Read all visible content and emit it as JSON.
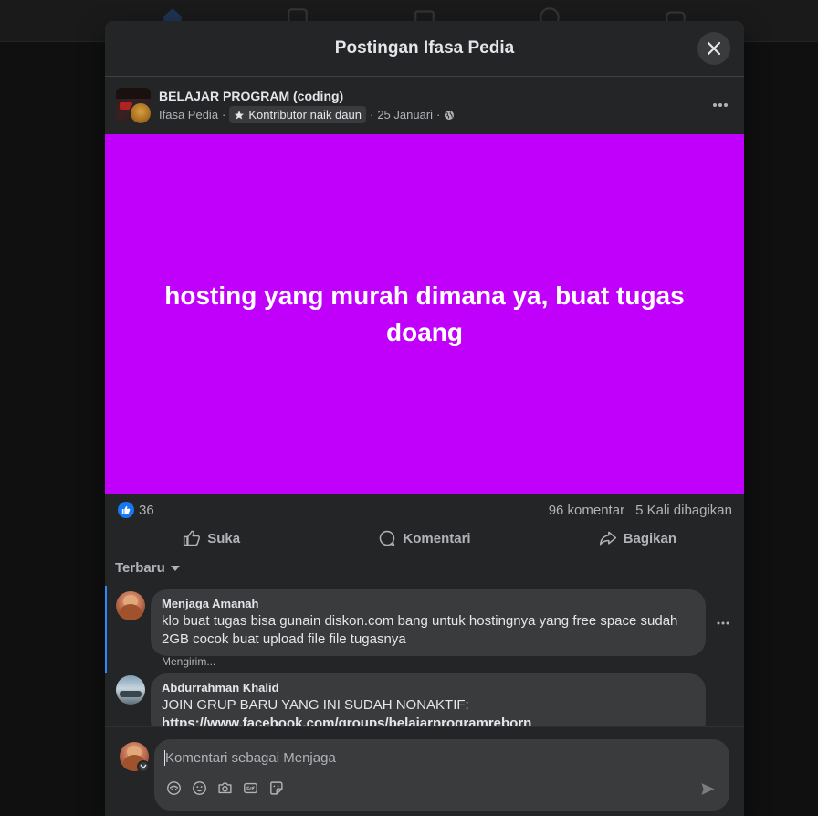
{
  "modal": {
    "title": "Postingan Ifasa Pedia"
  },
  "post": {
    "group_name": "BELAJAR PROGRAM (coding)",
    "author": "Ifasa Pedia",
    "badge": "Kontributor naik daun",
    "date": "25 Januari",
    "sep1": "·",
    "sep2": "·",
    "sep3": "·",
    "text": "hosting yang murah dimana ya, buat tugas doang",
    "background_color": "#c000fa",
    "reactions_count": "36",
    "comments_count": "96 komentar",
    "shares_count": "5 Kali dibagikan"
  },
  "actions": {
    "like": "Suka",
    "comment": "Komentari",
    "share": "Bagikan"
  },
  "sort": {
    "label": "Terbaru"
  },
  "comments": [
    {
      "author": "Menjaga Amanah",
      "text": "klo buat tugas bisa gunain diskon.com bang untuk hostingnya yang free space sudah 2GB cocok buat upload file file tugasnya",
      "status": "Mengirim..."
    },
    {
      "author": "Abdurrahman Khalid",
      "text": "JOIN GRUP BARU YANG INI SUDAH NONAKTIF:",
      "link": "https://www.facebook.com/groups/belajarprogramreborn"
    }
  ],
  "composer": {
    "placeholder": "Komentari sebagai Menjaga"
  },
  "colors": {
    "accent": "#1877f2",
    "panel": "#242526",
    "bubble": "#3a3b3c"
  }
}
